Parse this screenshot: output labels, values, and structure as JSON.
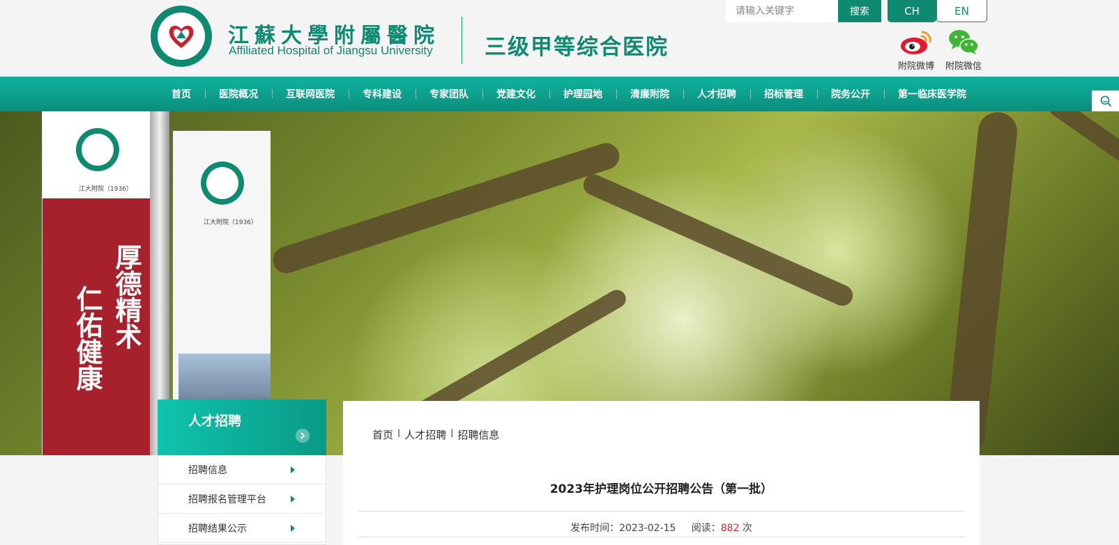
{
  "header": {
    "logo_cn": "江蘇大學附屬醫院",
    "logo_en": "Affiliated Hospital of Jiangsu University",
    "grade": "三级甲等综合医院",
    "search_placeholder": "请输入关键字",
    "search_button": "搜索",
    "lang_ch": "CH",
    "lang_en": "EN",
    "weibo_label": "附院微博",
    "wechat_label": "附院微信",
    "weibo_icon": "weibo-icon",
    "wechat_icon": "wechat-icon"
  },
  "nav": {
    "items": [
      {
        "label": "首页"
      },
      {
        "label": "医院概况"
      },
      {
        "label": "互联网医院"
      },
      {
        "label": "专科建设"
      },
      {
        "label": "专家团队"
      },
      {
        "label": "党建文化"
      },
      {
        "label": "护理园地"
      },
      {
        "label": "清廉附院"
      },
      {
        "label": "人才招聘"
      },
      {
        "label": "招标管理"
      },
      {
        "label": "院务公开"
      },
      {
        "label": "第一临床医学院"
      }
    ]
  },
  "sidebar": {
    "title": "人才招聘",
    "items": [
      {
        "label": "招聘信息"
      },
      {
        "label": "招聘报名管理平台"
      },
      {
        "label": "招聘结果公示"
      }
    ]
  },
  "breadcrumb": {
    "items": [
      "首页",
      "人才招聘",
      "招聘信息"
    ],
    "separator": "l"
  },
  "article": {
    "title": "2023年护理岗位公开招聘公告（第一批）",
    "date_label": "发布时间：",
    "date": "2023-02-15",
    "hits_label": "阅读：",
    "hits": "882",
    "hits_unit": "次"
  },
  "colors": {
    "brand": "#0d8a6f",
    "nav_top": "#11b3a0",
    "accent_red": "#d9272e"
  }
}
